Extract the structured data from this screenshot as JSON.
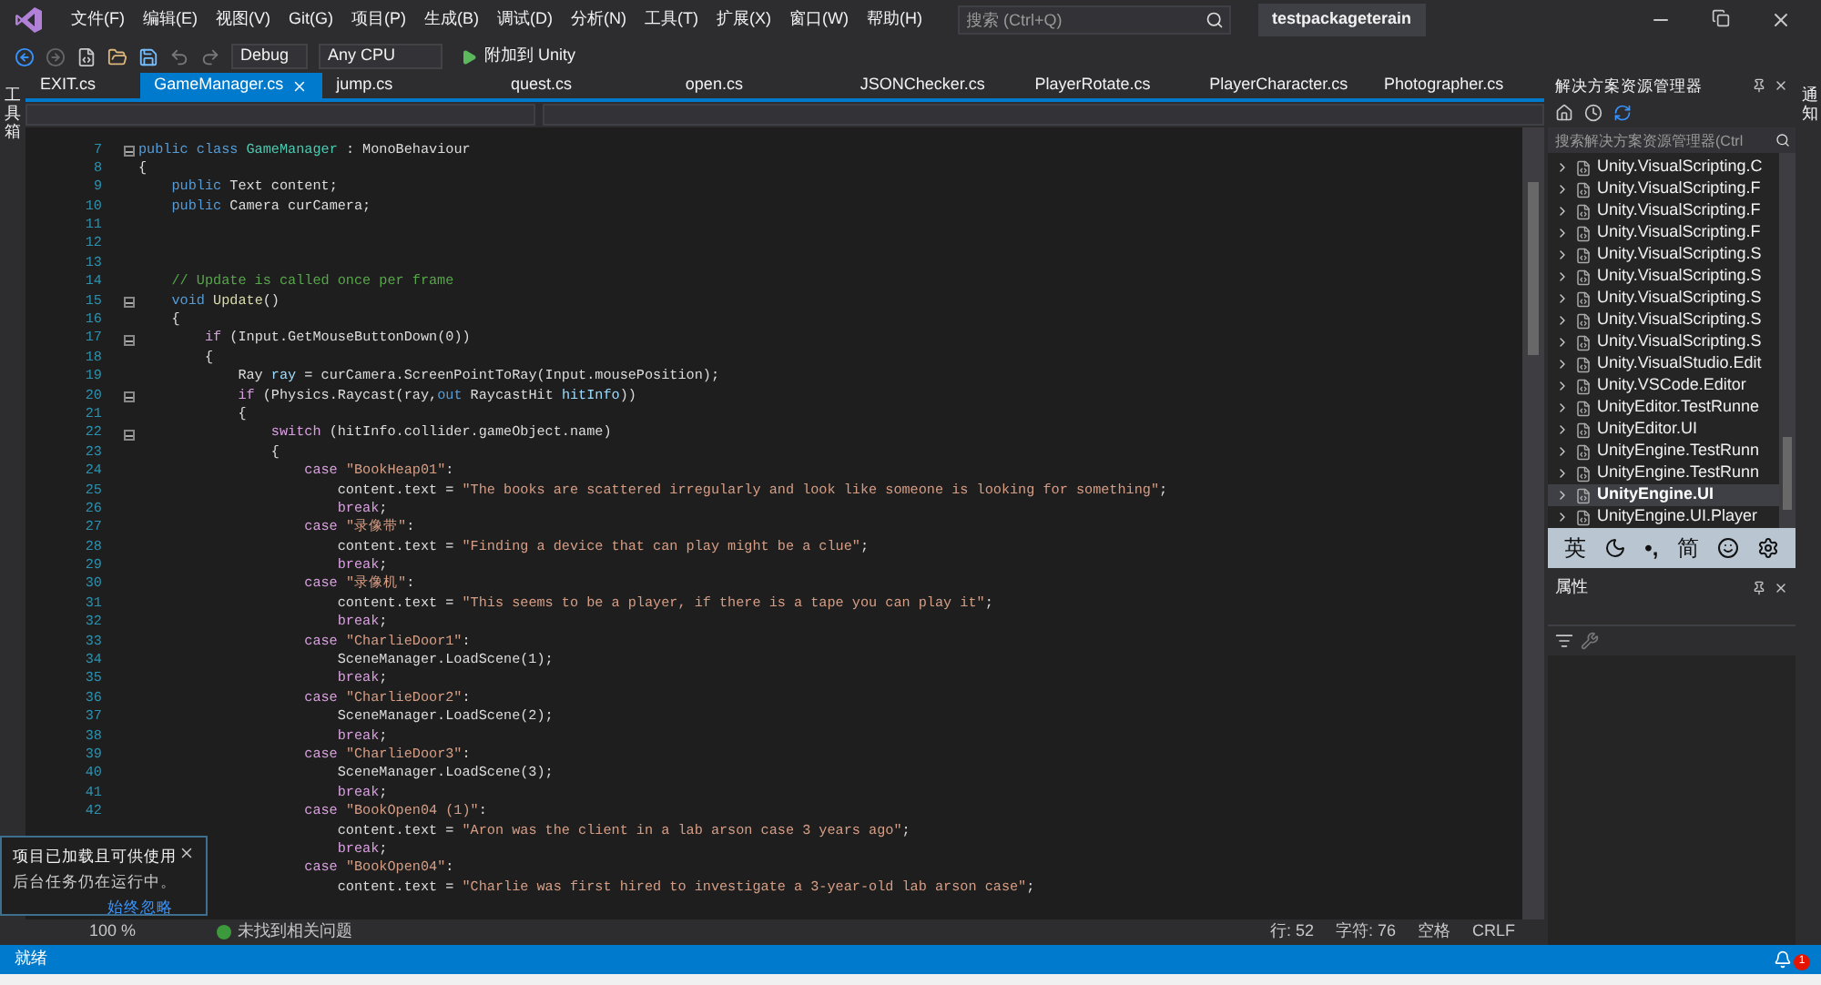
{
  "menu": [
    "文件(F)",
    "编辑(E)",
    "视图(V)",
    "Git(G)",
    "项目(P)",
    "生成(B)",
    "调试(D)",
    "分析(N)",
    "工具(T)",
    "扩展(X)",
    "窗口(W)",
    "帮助(H)"
  ],
  "search": {
    "placeholder": "搜索 (Ctrl+Q)"
  },
  "window": {
    "title": "testpackageterain"
  },
  "toolbar": {
    "configuration": "Debug",
    "platform": "Any CPU",
    "run": "附加到 Unity"
  },
  "left_strip": "工具箱",
  "right_strip": "通知",
  "tabs": [
    {
      "label": "EXIT.cs",
      "selected": false
    },
    {
      "label": "GameManager.cs",
      "selected": true
    },
    {
      "label": "jump.cs",
      "selected": false
    },
    {
      "label": "quest.cs",
      "selected": false
    },
    {
      "label": "open.cs",
      "selected": false
    },
    {
      "label": "JSONChecker.cs",
      "selected": false
    },
    {
      "label": "PlayerRotate.cs",
      "selected": false
    },
    {
      "label": "PlayerCharacter.cs",
      "selected": false
    },
    {
      "label": "Photographer.cs",
      "selected": false
    }
  ],
  "code": [
    {
      "number": "7",
      "fold": true,
      "tokens": [
        {
          "kind": "kw",
          "t": "public class "
        },
        {
          "kind": "type",
          "t": "GameManager"
        },
        {
          "kind": "plain",
          "t": " : MonoBehaviour"
        }
      ]
    },
    {
      "number": "8",
      "fold": false,
      "tokens": [
        {
          "kind": "plain",
          "t": "{"
        }
      ]
    },
    {
      "number": "9",
      "fold": false,
      "tokens": [
        {
          "kind": "kw",
          "t": "    public"
        },
        {
          "kind": "plain",
          "t": " Text content;"
        }
      ]
    },
    {
      "number": "10",
      "fold": false,
      "tokens": [
        {
          "kind": "kw",
          "t": "    public"
        },
        {
          "kind": "plain",
          "t": " Camera curCamera;"
        }
      ]
    },
    {
      "number": "11",
      "fold": false
    },
    {
      "number": "12",
      "fold": false
    },
    {
      "number": "13",
      "fold": false
    },
    {
      "number": "14",
      "fold": false,
      "tokens": [
        {
          "kind": "cm",
          "t": "    // Update is called once per frame"
        }
      ]
    },
    {
      "number": "15",
      "fold": true,
      "tokens": [
        {
          "kind": "kw",
          "t": "    void "
        },
        {
          "kind": "method",
          "t": "Update"
        },
        {
          "kind": "plain",
          "t": "()"
        }
      ]
    },
    {
      "number": "16",
      "fold": false,
      "tokens": [
        {
          "kind": "plain",
          "t": "    {"
        }
      ]
    },
    {
      "number": "17",
      "fold": true,
      "tokens": [
        {
          "kind": "ctrl",
          "t": "        if"
        },
        {
          "kind": "plain",
          "t": " (Input.GetMouseButtonDown(0))"
        }
      ]
    },
    {
      "number": "18",
      "fold": false,
      "tokens": [
        {
          "kind": "plain",
          "t": "        {"
        }
      ]
    },
    {
      "number": "19",
      "fold": false,
      "tokens": [
        {
          "kind": "plain",
          "t": "            Ray "
        },
        {
          "kind": "var",
          "t": "ray"
        },
        {
          "kind": "plain",
          "t": " = curCamera.ScreenPointToRay(Input.mousePosition);"
        }
      ]
    },
    {
      "number": "20",
      "fold": true,
      "tokens": [
        {
          "kind": "ctrl",
          "t": "            if"
        },
        {
          "kind": "plain",
          "t": " (Physics.Raycast(ray,"
        },
        {
          "kind": "kw",
          "t": "out"
        },
        {
          "kind": "plain",
          "t": " RaycastHit "
        },
        {
          "kind": "var",
          "t": "hitInfo"
        },
        {
          "kind": "plain",
          "t": "))"
        }
      ]
    },
    {
      "number": "21",
      "fold": false,
      "tokens": [
        {
          "kind": "plain",
          "t": "            {"
        }
      ]
    },
    {
      "number": "22",
      "fold": true,
      "tokens": [
        {
          "kind": "ctrl",
          "t": "                switch"
        },
        {
          "kind": "plain",
          "t": " (hitInfo.collider.gameObject.name)"
        }
      ]
    },
    {
      "number": "23",
      "fold": false,
      "tokens": [
        {
          "kind": "plain",
          "t": "                {"
        }
      ]
    },
    {
      "number": "24",
      "fold": false,
      "tokens": [
        {
          "kind": "ctrl",
          "t": "                    case "
        },
        {
          "kind": "str",
          "t": "\"BookHeap01\""
        },
        {
          "kind": "plain",
          "t": ":"
        }
      ]
    },
    {
      "number": "25",
      "fold": false,
      "tokens": [
        {
          "kind": "plain",
          "t": "                        content.text = "
        },
        {
          "kind": "str",
          "t": "\"The books are scattered irregularly and look like someone is looking for something\""
        },
        {
          "kind": "plain",
          "t": ";"
        }
      ]
    },
    {
      "number": "26",
      "fold": false,
      "tokens": [
        {
          "kind": "ctrl",
          "t": "                        break"
        },
        {
          "kind": "plain",
          "t": ";"
        }
      ]
    },
    {
      "number": "27",
      "fold": false,
      "tokens": [
        {
          "kind": "ctrl",
          "t": "                    case "
        },
        {
          "kind": "str",
          "t": "\"录像带\""
        },
        {
          "kind": "plain",
          "t": ":"
        }
      ]
    },
    {
      "number": "28",
      "fold": false,
      "tokens": [
        {
          "kind": "plain",
          "t": "                        content.text = "
        },
        {
          "kind": "str",
          "t": "\"Finding a device that can play might be a clue\""
        },
        {
          "kind": "plain",
          "t": ";"
        }
      ]
    },
    {
      "number": "29",
      "fold": false,
      "tokens": [
        {
          "kind": "ctrl",
          "t": "                        break"
        },
        {
          "kind": "plain",
          "t": ";"
        }
      ]
    },
    {
      "number": "30",
      "fold": false,
      "tokens": [
        {
          "kind": "ctrl",
          "t": "                    case "
        },
        {
          "kind": "str",
          "t": "\"录像机\""
        },
        {
          "kind": "plain",
          "t": ":"
        }
      ]
    },
    {
      "number": "31",
      "fold": false,
      "tokens": [
        {
          "kind": "plain",
          "t": "                        content.text = "
        },
        {
          "kind": "str",
          "t": "\"This seems to be a player, if there is a tape you can play it\""
        },
        {
          "kind": "plain",
          "t": ";"
        }
      ]
    },
    {
      "number": "32",
      "fold": false,
      "tokens": [
        {
          "kind": "ctrl",
          "t": "                        break"
        },
        {
          "kind": "plain",
          "t": ";"
        }
      ]
    },
    {
      "number": "33",
      "fold": false,
      "tokens": [
        {
          "kind": "ctrl",
          "t": "                    case "
        },
        {
          "kind": "str",
          "t": "\"CharlieDoor1\""
        },
        {
          "kind": "plain",
          "t": ":"
        }
      ]
    },
    {
      "number": "34",
      "fold": false,
      "tokens": [
        {
          "kind": "plain",
          "t": "                        SceneManager.LoadScene(1);"
        }
      ]
    },
    {
      "number": "35",
      "fold": false,
      "tokens": [
        {
          "kind": "ctrl",
          "t": "                        break"
        },
        {
          "kind": "plain",
          "t": ";"
        }
      ]
    },
    {
      "number": "36",
      "fold": false,
      "tokens": [
        {
          "kind": "ctrl",
          "t": "                    case "
        },
        {
          "kind": "str",
          "t": "\"CharlieDoor2\""
        },
        {
          "kind": "plain",
          "t": ":"
        }
      ]
    },
    {
      "number": "37",
      "fold": false,
      "tokens": [
        {
          "kind": "plain",
          "t": "                        SceneManager.LoadScene(2);"
        }
      ]
    },
    {
      "number": "38",
      "fold": false,
      "tokens": [
        {
          "kind": "ctrl",
          "t": "                        break"
        },
        {
          "kind": "plain",
          "t": ";"
        }
      ]
    },
    {
      "number": "39",
      "fold": false,
      "tokens": [
        {
          "kind": "ctrl",
          "t": "                    case "
        },
        {
          "kind": "str",
          "t": "\"CharlieDoor3\""
        },
        {
          "kind": "plain",
          "t": ":"
        }
      ]
    },
    {
      "number": "40",
      "fold": false,
      "tokens": [
        {
          "kind": "plain",
          "t": "                        SceneManager.LoadScene(3);"
        }
      ]
    },
    {
      "number": "41",
      "fold": false,
      "tokens": [
        {
          "kind": "ctrl",
          "t": "                        break"
        },
        {
          "kind": "plain",
          "t": ";"
        }
      ]
    },
    {
      "number": "42",
      "fold": false,
      "tokens": [
        {
          "kind": "ctrl",
          "t": "                    case "
        },
        {
          "kind": "str",
          "t": "\"BookOpen04 (1)\""
        },
        {
          "kind": "plain",
          "t": ":"
        }
      ]
    },
    {
      "fold": false,
      "tokens": [
        {
          "kind": "plain",
          "t": "                        content.text = "
        },
        {
          "kind": "str",
          "t": "\"Aron was the client in a lab arson case 3 years ago\""
        },
        {
          "kind": "plain",
          "t": ";"
        }
      ]
    },
    {
      "fold": false,
      "tokens": [
        {
          "kind": "ctrl",
          "t": "                        break"
        },
        {
          "kind": "plain",
          "t": ";"
        }
      ]
    },
    {
      "fold": false,
      "tokens": [
        {
          "kind": "ctrl",
          "t": "                    case "
        },
        {
          "kind": "str",
          "t": "\"BookOpen04\""
        },
        {
          "kind": "plain",
          "t": ":"
        }
      ]
    },
    {
      "fold": false,
      "tokens": [
        {
          "kind": "plain",
          "t": "                        content.text = "
        },
        {
          "kind": "str",
          "t": "\"Charlie was first hired to investigate a 3-year-old lab arson case\""
        },
        {
          "kind": "plain",
          "t": ";"
        }
      ]
    }
  ],
  "solution_explorer": {
    "title": "解决方案资源管理器",
    "search_placeholder": "搜索解决方案资源管理器(Ctrl",
    "items": [
      {
        "label": "Unity.VisualScripting.C",
        "selected": false
      },
      {
        "label": "Unity.VisualScripting.F",
        "selected": false
      },
      {
        "label": "Unity.VisualScripting.F",
        "selected": false
      },
      {
        "label": "Unity.VisualScripting.F",
        "selected": false
      },
      {
        "label": "Unity.VisualScripting.S",
        "selected": false
      },
      {
        "label": "Unity.VisualScripting.S",
        "selected": false
      },
      {
        "label": "Unity.VisualScripting.S",
        "selected": false
      },
      {
        "label": "Unity.VisualScripting.S",
        "selected": false
      },
      {
        "label": "Unity.VisualScripting.S",
        "selected": false
      },
      {
        "label": "Unity.VisualStudio.Edit",
        "selected": false
      },
      {
        "label": "Unity.VSCode.Editor",
        "selected": false
      },
      {
        "label": "UnityEditor.TestRunne",
        "selected": false
      },
      {
        "label": "UnityEditor.UI",
        "selected": false
      },
      {
        "label": "UnityEngine.TestRunn",
        "selected": false
      },
      {
        "label": "UnityEngine.TestRunn",
        "selected": false
      },
      {
        "label": "UnityEngine.UI",
        "selected": true
      },
      {
        "label": "UnityEngine.UI.Player",
        "selected": false
      }
    ]
  },
  "ime_bar": {
    "language": "英",
    "punctuation": "•,",
    "script": "简"
  },
  "properties": {
    "title": "属性"
  },
  "notification": {
    "title": "项目已加载且可供使用",
    "message": "后台任务仍在运行中。",
    "link": "始终忽略"
  },
  "editor_status": {
    "zoom": "100 %",
    "issues": "未找到相关问题",
    "line": "行: 52",
    "column": "字符: 76",
    "whitespace": "空格",
    "line_ending": "CRLF"
  },
  "status_bar": {
    "text": "就绪",
    "notifications": "1"
  }
}
